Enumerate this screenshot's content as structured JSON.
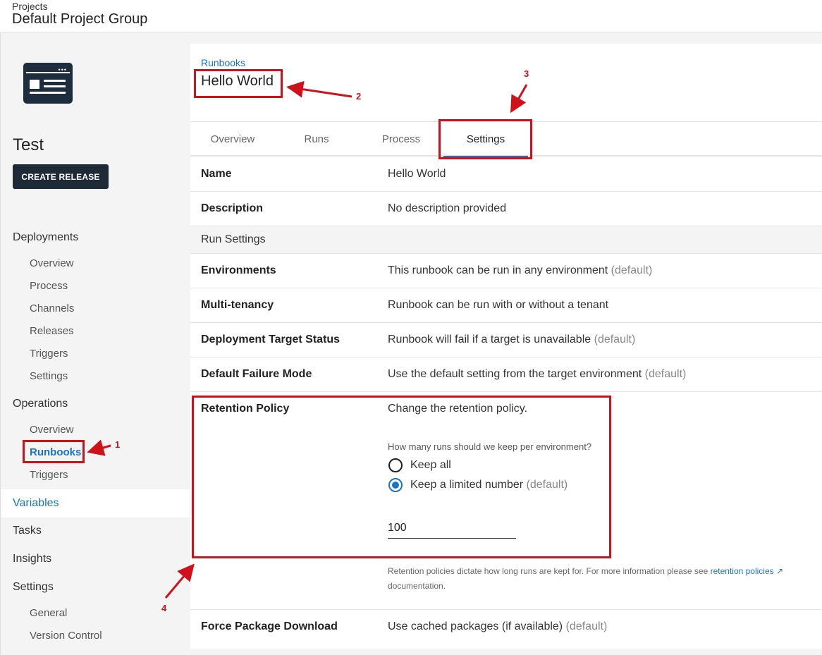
{
  "header": {
    "breadcrumb": "Projects",
    "title": "Default Project Group"
  },
  "sidebar": {
    "logo_icon": "project-screen-icon",
    "project_name": "Test",
    "create_release_label": "CREATE RELEASE",
    "deployments": {
      "label": "Deployments",
      "items": [
        "Overview",
        "Process",
        "Channels",
        "Releases",
        "Triggers",
        "Settings"
      ]
    },
    "operations": {
      "label": "Operations",
      "items": [
        "Overview",
        "Runbooks",
        "Triggers"
      ],
      "active": "Runbooks"
    },
    "variables_label": "Variables",
    "tasks_label": "Tasks",
    "insights_label": "Insights",
    "settings": {
      "label": "Settings",
      "items": [
        "General",
        "Version Control"
      ]
    }
  },
  "main": {
    "breadcrumb_link": "Runbooks",
    "title": "Hello World",
    "tabs": [
      {
        "label": "Overview"
      },
      {
        "label": "Runs"
      },
      {
        "label": "Process"
      },
      {
        "label": "Settings",
        "active": true
      }
    ],
    "fields": {
      "name": {
        "label": "Name",
        "value": "Hello World"
      },
      "description": {
        "label": "Description",
        "value": "No description provided"
      },
      "run_settings_heading": "Run Settings",
      "environments": {
        "label": "Environments",
        "value": "This runbook can be run in any environment",
        "suffix": "(default)"
      },
      "multi_tenancy": {
        "label": "Multi-tenancy",
        "value": "Runbook can be run with or without a tenant"
      },
      "target_status": {
        "label": "Deployment Target Status",
        "value": "Runbook will fail if a target is unavailable",
        "suffix": "(default)"
      },
      "failure_mode": {
        "label": "Default Failure Mode",
        "value": "Use the default setting from the target environment",
        "suffix": "(default)"
      },
      "retention": {
        "label": "Retention Policy",
        "value": "Change the retention policy.",
        "question": "How many runs should we keep per environment?",
        "option_all": "Keep all",
        "option_limited": "Keep a limited number",
        "option_limited_suffix": "(default)",
        "selected": "limited",
        "count": "100",
        "help_text": "Retention policies dictate how long runs are kept for. For more information please see",
        "help_link": "retention policies",
        "help_tail": "documentation."
      },
      "force_package": {
        "label": "Force Package Download",
        "value": "Use cached packages (if available)",
        "suffix": "(default)"
      }
    }
  },
  "annotations": {
    "color": "#d0101a",
    "numbers": [
      "1",
      "2",
      "3",
      "4"
    ]
  }
}
